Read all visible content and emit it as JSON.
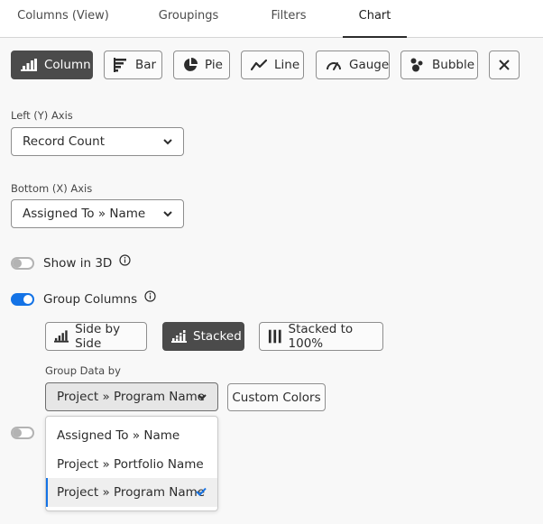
{
  "tabs": [
    {
      "label": "Columns (View)",
      "active": false
    },
    {
      "label": "Groupings",
      "active": false
    },
    {
      "label": "Filters",
      "active": false
    },
    {
      "label": "Chart",
      "active": true
    }
  ],
  "chart_types": [
    {
      "label": "Column",
      "icon": "column-chart-icon",
      "selected": true
    },
    {
      "label": "Bar",
      "icon": "bar-chart-icon",
      "selected": false
    },
    {
      "label": "Pie",
      "icon": "pie-chart-icon",
      "selected": false
    },
    {
      "label": "Line",
      "icon": "line-chart-icon",
      "selected": false
    },
    {
      "label": "Gauge",
      "icon": "gauge-icon",
      "selected": false
    },
    {
      "label": "Bubble",
      "icon": "bubble-chart-icon",
      "selected": false
    }
  ],
  "close_icon": "close-icon",
  "left_axis": {
    "label": "Left (Y) Axis",
    "value": "Record Count"
  },
  "bottom_axis": {
    "label": "Bottom (X) Axis",
    "value": "Assigned To » Name"
  },
  "show_3d": {
    "label": "Show in 3D",
    "on": false
  },
  "group_columns": {
    "label": "Group Columns",
    "on": true
  },
  "group_modes": [
    {
      "label": "Side by Side",
      "icon": "side-by-side-icon",
      "selected": false
    },
    {
      "label": "Stacked",
      "icon": "stacked-icon",
      "selected": true
    },
    {
      "label": "Stacked to 100%",
      "icon": "stacked-100-icon",
      "selected": false
    }
  ],
  "group_data_by": {
    "label": "Group Data by",
    "value": "Project » Program Name",
    "options": [
      {
        "label": "Assigned To » Name",
        "selected": false
      },
      {
        "label": "Project » Portfolio Name",
        "selected": false
      },
      {
        "label": "Project » Program Name",
        "selected": true
      }
    ]
  },
  "custom_colors_label": "Custom Colors",
  "colors": {
    "accent": "#1473e6",
    "selected_button": "#4b4b4b"
  }
}
